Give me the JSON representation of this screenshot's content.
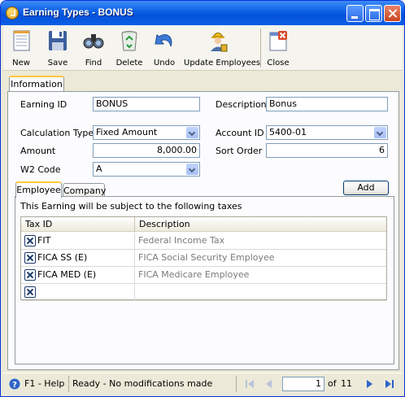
{
  "window": {
    "title": "Earning Types - BONUS"
  },
  "toolbar": {
    "new": "New",
    "save": "Save",
    "find": "Find",
    "delete": "Delete",
    "undo": "Undo",
    "update_employees": "Update Employees",
    "close": "Close"
  },
  "tabs": {
    "information": "Information"
  },
  "form": {
    "earning_id_label": "Earning ID",
    "earning_id": "BONUS",
    "description_label": "Description",
    "description": "Bonus",
    "calc_type_label": "Calculation Type",
    "calc_type": "Fixed Amount",
    "account_id_label": "Account ID",
    "account_id": "5400-01",
    "amount_label": "Amount",
    "amount": "8,000.00",
    "sort_order_label": "Sort Order",
    "sort_order": "6",
    "w2_code_label": "W2 Code",
    "w2_code": "A"
  },
  "subtabs": {
    "employee": "Employee",
    "company": "Company"
  },
  "add_button": "Add",
  "taxes": {
    "caption": "This Earning will be subject to the following taxes",
    "columns": [
      "Tax ID",
      "Description"
    ],
    "rows": [
      {
        "tax_id": "FIT",
        "description": "Federal Income Tax"
      },
      {
        "tax_id": "FICA SS (E)",
        "description": "FICA Social Security Employee"
      },
      {
        "tax_id": "FICA MED (E)",
        "description": "FICA Medicare Employee"
      },
      {
        "tax_id": "",
        "description": ""
      }
    ]
  },
  "status": {
    "help": "F1 - Help",
    "message": "Ready - No modifications made",
    "record": "1",
    "of_label": "of",
    "total": "11"
  },
  "colors": {
    "title_bar": "#0A5FE6",
    "tab_highlight": "#FFC83C",
    "window_bg": "#ECE9D8"
  }
}
